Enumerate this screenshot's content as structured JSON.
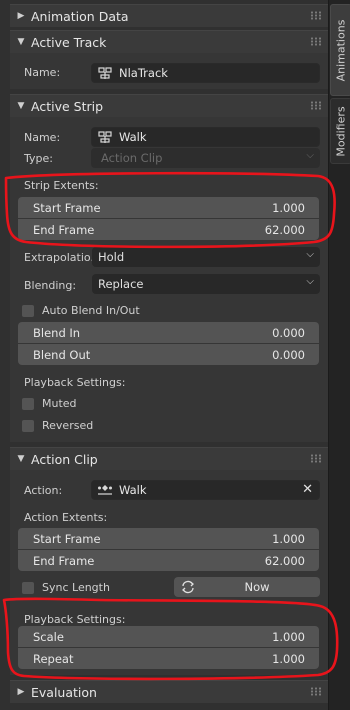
{
  "sidebar": {
    "tabs": [
      {
        "label": "Animations"
      },
      {
        "label": "Modifiers"
      }
    ]
  },
  "panels": {
    "animation_data": {
      "title": "Animation Data"
    },
    "active_track": {
      "title": "Active Track",
      "name_label": "Name:",
      "name_value": "NlaTrack"
    },
    "active_strip": {
      "title": "Active Strip",
      "name_label": "Name:",
      "name_value": "Walk",
      "type_label": "Type:",
      "type_value": "Action Clip",
      "strip_extents_label": "Strip Extents:",
      "start_frame_label": "Start Frame",
      "start_frame_value": "1.000",
      "end_frame_label": "End Frame",
      "end_frame_value": "62.000",
      "extrapolation_label": "Extrapolatio...",
      "extrapolation_value": "Hold",
      "blending_label": "Blending:",
      "blending_value": "Replace",
      "auto_blend_label": "Auto Blend In/Out",
      "blend_in_label": "Blend In",
      "blend_in_value": "0.000",
      "blend_out_label": "Blend Out",
      "blend_out_value": "0.000",
      "playback_label": "Playback Settings:",
      "muted_label": "Muted",
      "reversed_label": "Reversed"
    },
    "action_clip": {
      "title": "Action Clip",
      "action_label": "Action:",
      "action_value": "Walk",
      "extents_label": "Action Extents:",
      "start_frame_label": "Start Frame",
      "start_frame_value": "1.000",
      "end_frame_label": "End Frame",
      "end_frame_value": "62.000",
      "sync_length_label": "Sync Length",
      "now_label": "Now",
      "playback_label": "Playback Settings:",
      "scale_label": "Scale",
      "scale_value": "1.000",
      "repeat_label": "Repeat",
      "repeat_value": "1.000"
    },
    "evaluation": {
      "title": "Evaluation"
    }
  },
  "colors": {
    "annotation": "#e8141b",
    "panel_bg": "#363636",
    "header_bg": "#3a3a3a",
    "field_bg": "#545454"
  }
}
